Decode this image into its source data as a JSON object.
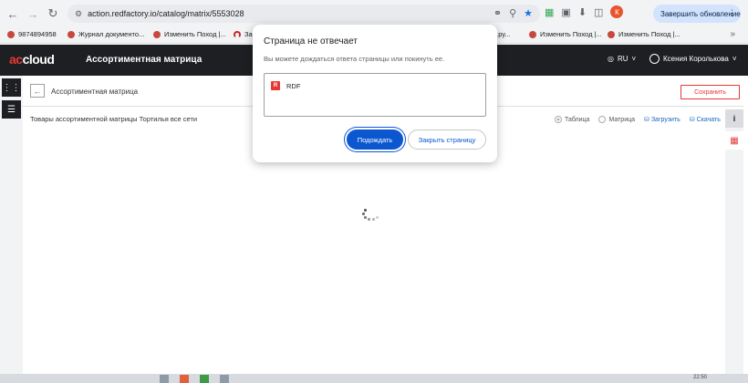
{
  "browser": {
    "url": "action.redfactory.io/catalog/matrix/5553028",
    "update_button": "Завершить обновление",
    "avatar_letter": "К"
  },
  "bookmarks": {
    "items": [
      {
        "label": "9874894958"
      },
      {
        "label": "Журнал документо..."
      },
      {
        "label": "Изменить Поход |..."
      },
      {
        "label": "За"
      },
      {
        "label": "...ру..."
      },
      {
        "label": "Изменить Поход |..."
      },
      {
        "label": "Изменить Поход |..."
      }
    ]
  },
  "app": {
    "logo_prefix": "ac",
    "logo_suffix": "cloud",
    "title": "Ассортиментная матрица",
    "language": "RU",
    "user_name": "Ксения Королькова"
  },
  "page": {
    "title": "Ассортиментная матрица",
    "save_label": "Сохранить",
    "products_label": "Товары ассортиментной матрицы Тортилья все сети",
    "view_table": "Таблица",
    "view_matrix": "Матрица",
    "upload": "Загрузить",
    "download": "Скачать"
  },
  "dialog": {
    "title": "Страница не отвечает",
    "text": "Вы можете дождаться ответа страницы или покинуть ее.",
    "item_label": "RDF",
    "wait_label": "Подождать",
    "close_label": "Закрыть страницу"
  },
  "taskbar": {
    "time": "22:50"
  },
  "colors": {
    "accent_red": "#e53935",
    "chrome_blue": "#0b57d0",
    "appbar": "#1e1f22"
  }
}
